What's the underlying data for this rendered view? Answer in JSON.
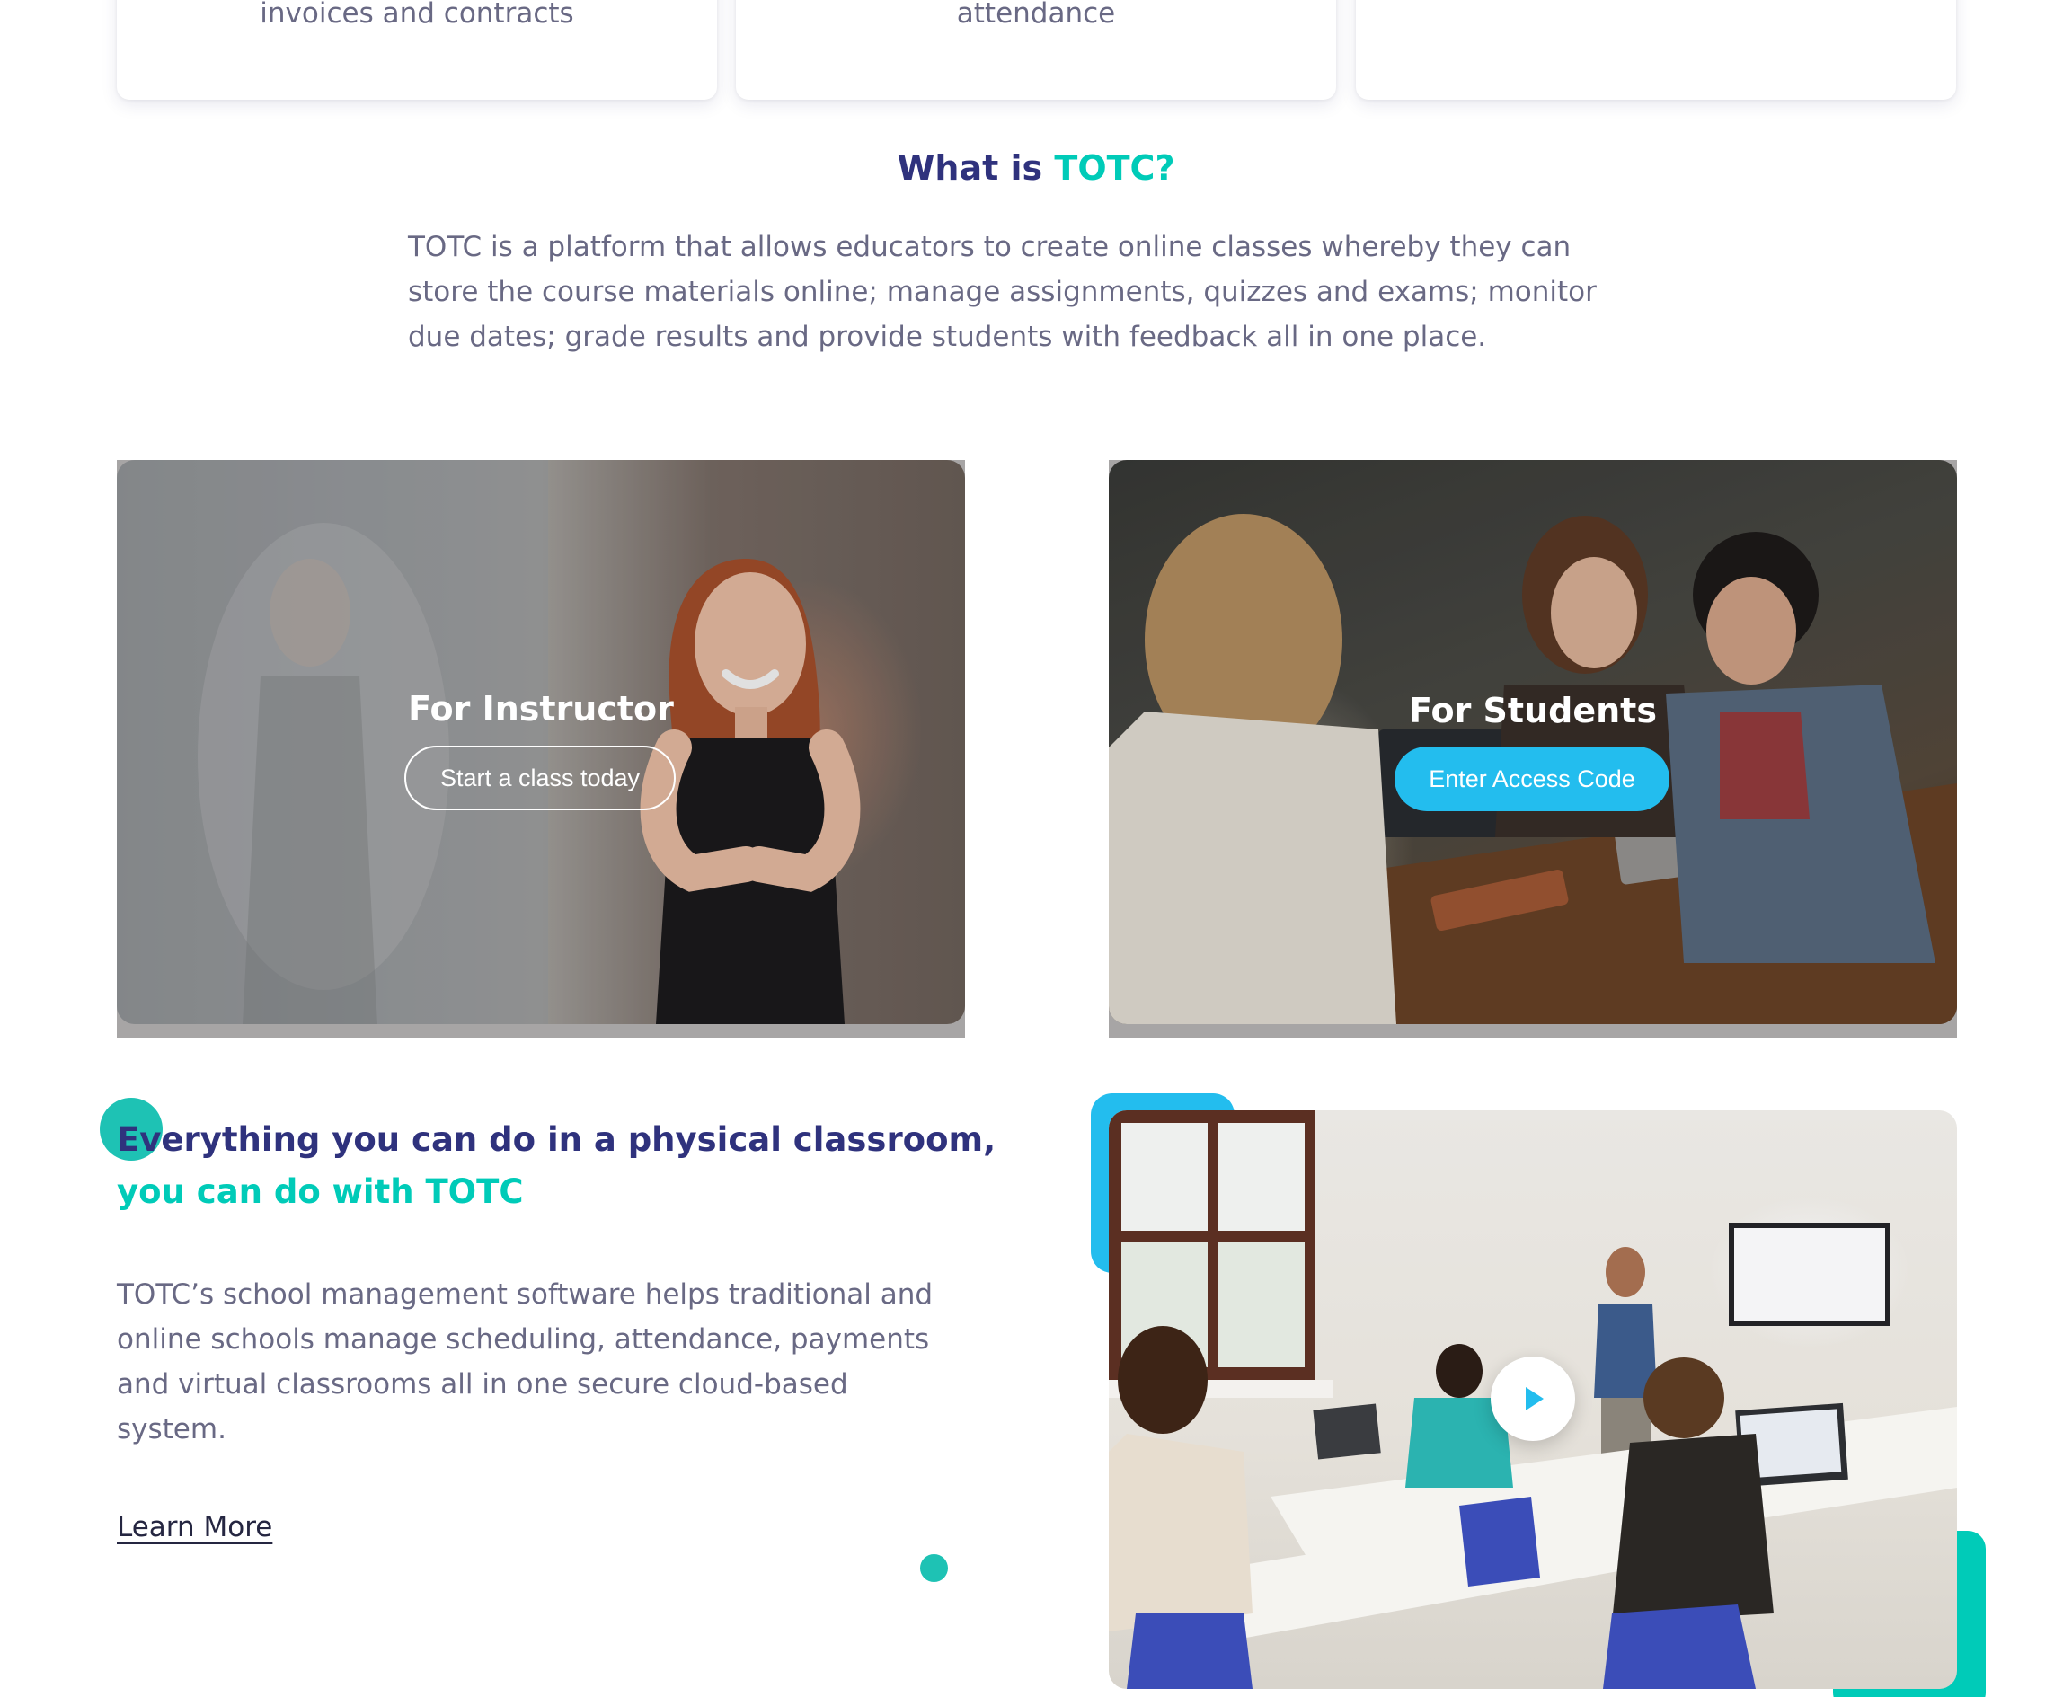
{
  "cards": [
    {
      "text": "invoices and contracts"
    },
    {
      "text": "attendance"
    },
    {
      "text": "..."
    }
  ],
  "about": {
    "title_main": "What is ",
    "title_accent": "TOTC?",
    "body_lines": [
      "TOTC is a platform that allows educators to create online classes whereby they can",
      "store the course materials online; manage assignments, quizzes and exams; monitor",
      "due dates; grade results and provide students with feedback all in one place."
    ]
  },
  "instructor": {
    "title": "For Instructor",
    "button": "Start a class today"
  },
  "students": {
    "title": "For Students",
    "button": "Enter Access Code"
  },
  "feature": {
    "heading_main": "Everything you can do in a physical classroom,",
    "heading_accent": "you can do with TOTC",
    "body_lines": [
      "TOTC’s school management software helps traditional and",
      "online schools manage scheduling, attendance, payments",
      "and virtual classrooms all in one secure cloud-based",
      "system."
    ],
    "link": "Learn More"
  },
  "video": {
    "play_icon": "play-icon"
  },
  "colors": {
    "navy": "#2F327D",
    "teal": "#00CBB8",
    "blue": "#23BDEE",
    "body_text": "#696984"
  }
}
